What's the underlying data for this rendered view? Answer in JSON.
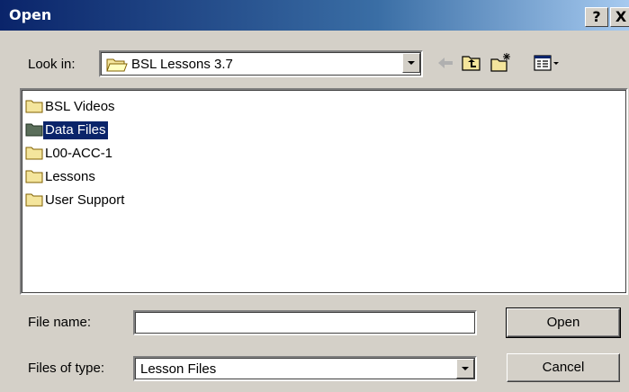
{
  "window": {
    "title": "Open",
    "help_label": "?",
    "close_label": "X"
  },
  "look_in": {
    "label": "Look in:",
    "value": "BSL Lessons 3.7"
  },
  "toolbar": {
    "icons": [
      "back-arrow-icon",
      "up-one-level-icon",
      "new-folder-icon",
      "view-menu-icon"
    ]
  },
  "files": [
    {
      "name": "BSL Videos",
      "selected": false
    },
    {
      "name": "Data Files",
      "selected": true
    },
    {
      "name": "L00-ACC-1",
      "selected": false
    },
    {
      "name": "Lessons",
      "selected": false
    },
    {
      "name": "User Support",
      "selected": false
    }
  ],
  "file_name": {
    "label": "File name:",
    "value": ""
  },
  "files_of_type": {
    "label": "Files of type:",
    "value": "Lesson Files"
  },
  "buttons": {
    "open": "Open",
    "cancel": "Cancel"
  },
  "colors": {
    "selection": "#0a246a",
    "folder": "#f4e59c",
    "folder_selected": "#5a6e5a"
  }
}
